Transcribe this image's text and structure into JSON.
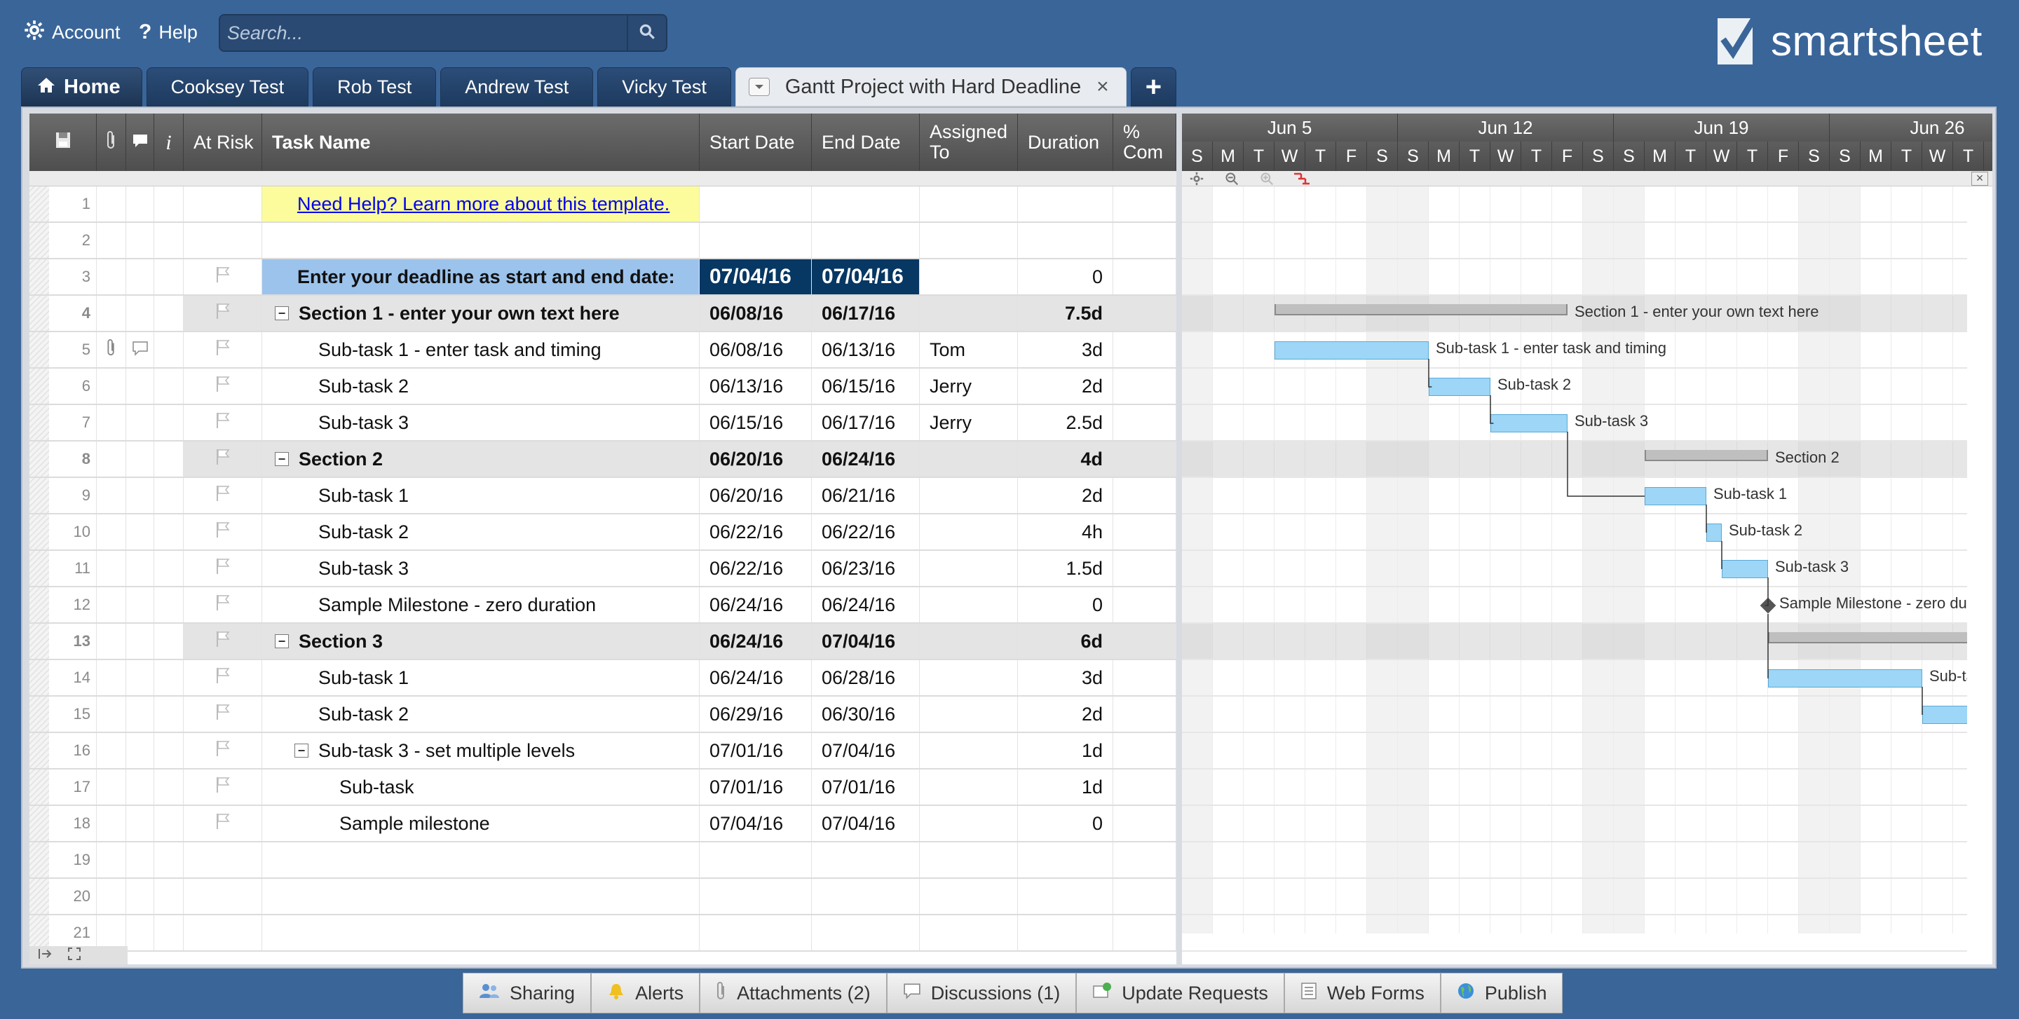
{
  "top": {
    "account_label": "Account",
    "help_label": "Help",
    "search_placeholder": "Search...",
    "logo_text": "smartsheet"
  },
  "tabs": [
    {
      "label": "Home"
    },
    {
      "label": "Cooksey Test"
    },
    {
      "label": "Rob Test"
    },
    {
      "label": "Andrew Test"
    },
    {
      "label": "Vicky Test"
    },
    {
      "label": "Gantt Project with Hard Deadline"
    }
  ],
  "add_tab_label": "+",
  "close_tab_label": "×",
  "columns": {
    "at_risk": "At Risk",
    "task_name": "Task Name",
    "start_date": "Start Date",
    "end_date": "End Date",
    "assigned_to": "Assigned To",
    "duration": "Duration",
    "percent_complete": "% Com"
  },
  "rows": [
    {
      "n": "1",
      "type": "help",
      "task": "Need Help? Learn more about this template.",
      "start": "",
      "end": "",
      "assigned": "",
      "duration": ""
    },
    {
      "n": "2",
      "type": "blank",
      "task": "",
      "start": "",
      "end": "",
      "assigned": "",
      "duration": ""
    },
    {
      "n": "3",
      "type": "deadline",
      "task": "Enter your deadline as start and end date:",
      "start": "07/04/16",
      "end": "07/04/16",
      "assigned": "",
      "duration": "0"
    },
    {
      "n": "4",
      "type": "section",
      "task": "Section 1 - enter your own text here",
      "start": "06/08/16",
      "end": "06/17/16",
      "assigned": "",
      "duration": "7.5d"
    },
    {
      "n": "5",
      "type": "task",
      "task": "Sub-task 1 - enter task and timing",
      "start": "06/08/16",
      "end": "06/13/16",
      "assigned": "Tom",
      "duration": "3d"
    },
    {
      "n": "6",
      "type": "task",
      "task": "Sub-task 2",
      "start": "06/13/16",
      "end": "06/15/16",
      "assigned": "Jerry",
      "duration": "2d"
    },
    {
      "n": "7",
      "type": "task",
      "task": "Sub-task 3",
      "start": "06/15/16",
      "end": "06/17/16",
      "assigned": "Jerry",
      "duration": "2.5d"
    },
    {
      "n": "8",
      "type": "section",
      "task": "Section 2",
      "start": "06/20/16",
      "end": "06/24/16",
      "assigned": "",
      "duration": "4d"
    },
    {
      "n": "9",
      "type": "task",
      "task": "Sub-task 1",
      "start": "06/20/16",
      "end": "06/21/16",
      "assigned": "",
      "duration": "2d"
    },
    {
      "n": "10",
      "type": "task",
      "task": "Sub-task 2",
      "start": "06/22/16",
      "end": "06/22/16",
      "assigned": "",
      "duration": "4h"
    },
    {
      "n": "11",
      "type": "task",
      "task": "Sub-task 3",
      "start": "06/22/16",
      "end": "06/23/16",
      "assigned": "",
      "duration": "1.5d"
    },
    {
      "n": "12",
      "type": "task",
      "task": "Sample Milestone - zero duration",
      "start": "06/24/16",
      "end": "06/24/16",
      "assigned": "",
      "duration": "0"
    },
    {
      "n": "13",
      "type": "section",
      "task": "Section 3",
      "start": "06/24/16",
      "end": "07/04/16",
      "assigned": "",
      "duration": "6d"
    },
    {
      "n": "14",
      "type": "task",
      "task": "Sub-task 1",
      "start": "06/24/16",
      "end": "06/28/16",
      "assigned": "",
      "duration": "3d"
    },
    {
      "n": "15",
      "type": "task",
      "task": "Sub-task 2",
      "start": "06/29/16",
      "end": "06/30/16",
      "assigned": "",
      "duration": "2d"
    },
    {
      "n": "16",
      "type": "subsection",
      "task": "Sub-task 3 - set multiple levels",
      "start": "07/01/16",
      "end": "07/04/16",
      "assigned": "",
      "duration": "1d"
    },
    {
      "n": "17",
      "type": "subtask",
      "task": "Sub-task",
      "start": "07/01/16",
      "end": "07/01/16",
      "assigned": "",
      "duration": "1d"
    },
    {
      "n": "18",
      "type": "subtask",
      "task": "Sample milestone",
      "start": "07/04/16",
      "end": "07/04/16",
      "assigned": "",
      "duration": "0"
    },
    {
      "n": "19",
      "type": "blank",
      "task": "",
      "start": "",
      "end": "",
      "assigned": "",
      "duration": ""
    },
    {
      "n": "20",
      "type": "blank",
      "task": "",
      "start": "",
      "end": "",
      "assigned": "",
      "duration": ""
    },
    {
      "n": "21",
      "type": "blank",
      "task": "",
      "start": "",
      "end": "",
      "assigned": "",
      "duration": ""
    }
  ],
  "gantt": {
    "weeks": [
      "Jun 5",
      "Jun 12",
      "Jun 19",
      "Jun 26"
    ],
    "day_letters": [
      "S",
      "M",
      "T",
      "W",
      "T",
      "F",
      "S",
      "S",
      "M",
      "T",
      "W",
      "T",
      "F",
      "S",
      "S",
      "M",
      "T",
      "W",
      "T",
      "F",
      "S",
      "S",
      "M",
      "T",
      "W",
      "T"
    ],
    "bar_color": "#9dd6f6",
    "labels": {
      "r4": "Section 1 - enter your own text here",
      "r5": "Sub-task 1 - enter task and timing",
      "r6": "Sub-task 2",
      "r7": "Sub-task 3",
      "r8": "Section 2",
      "r9": "Sub-task 1",
      "r10": "Sub-task 2",
      "r11": "Sub-task 3",
      "r12": "Sample Milestone - zero dur",
      "r14": "Sub-ta"
    }
  },
  "bottom": {
    "sharing": "Sharing",
    "alerts": "Alerts",
    "attachments": "Attachments (2)",
    "discussions": "Discussions (1)",
    "update_requests": "Update Requests",
    "web_forms": "Web Forms",
    "publish": "Publish"
  }
}
